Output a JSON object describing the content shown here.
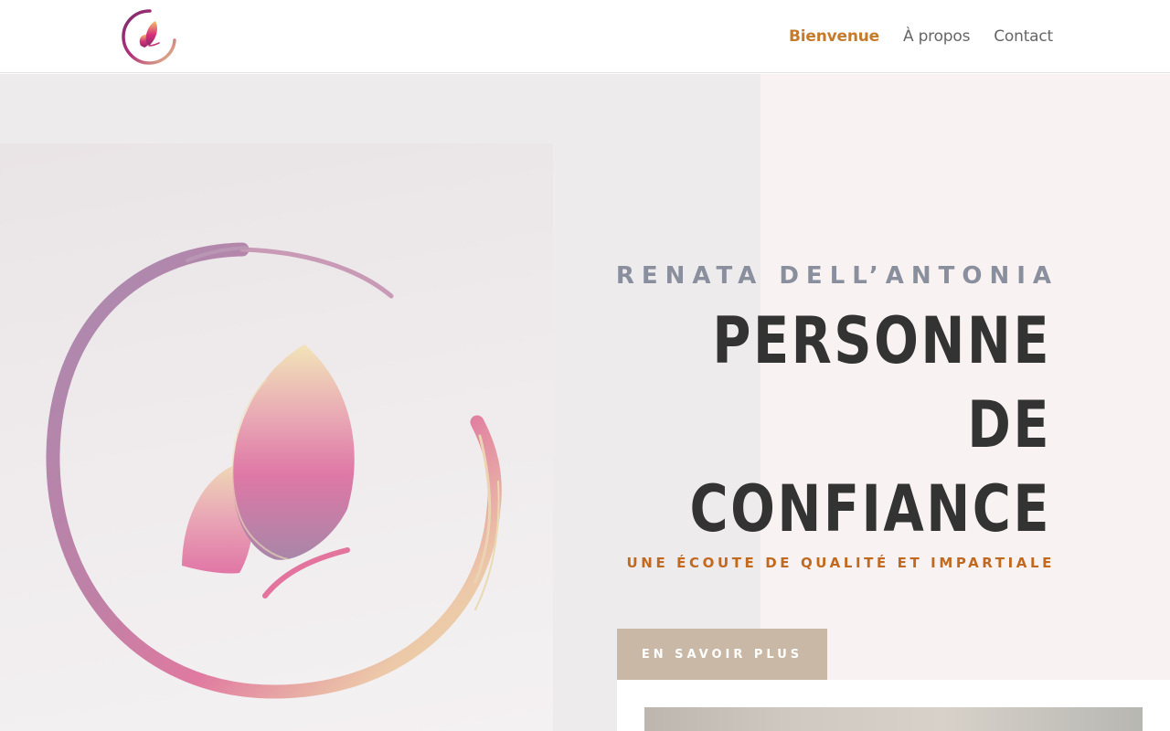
{
  "header": {
    "logo_icon": "butterfly-circle-logo",
    "nav": [
      {
        "label": "Bienvenue",
        "active": true
      },
      {
        "label": "À propos",
        "active": false
      },
      {
        "label": "Contact",
        "active": false
      }
    ]
  },
  "hero": {
    "kicker": "RENATA DELL’ANTONIA",
    "headline_line1": "PERSONNE DE",
    "headline_line2": "CONFIANCE",
    "tagline": "UNE ÉCOUTE DE QUALITÉ ET IMPARTIALE",
    "cta_label": "EN SAVOIR PLUS",
    "image_icon": "butterfly-brush-circle-illustration"
  },
  "colors": {
    "accent": "#c57a2c",
    "tagline": "#c0691f",
    "kicker": "#8a8f9e",
    "headline": "#333333",
    "cta_bg": "#c9b8a6",
    "bg_left": "#eeebec",
    "bg_right": "#f8f3f2"
  }
}
